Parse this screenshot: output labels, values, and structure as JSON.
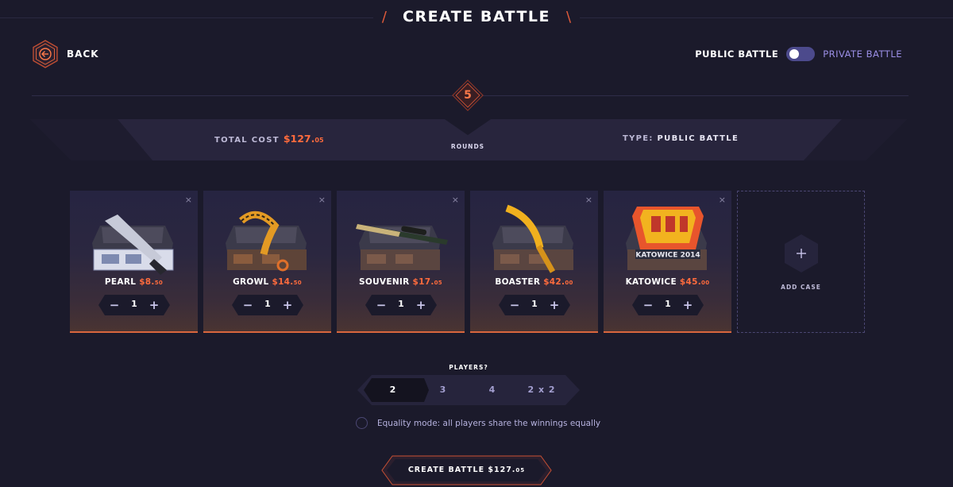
{
  "header": {
    "title": "CREATE BATTLE",
    "slash_left": "/",
    "slash_right": "\\"
  },
  "back": {
    "label": "BACK",
    "icon": "arrow-left-icon"
  },
  "visibility": {
    "left_label": "PUBLIC BATTLE",
    "right_label": "PRIVATE BATTLE",
    "selected": "public"
  },
  "rounds": {
    "count": "5",
    "label": "ROUNDS"
  },
  "summary": {
    "total_cost_label": "TOTAL COST",
    "total_cost_main": "$127.",
    "total_cost_cents": "05",
    "type_label": "TYPE:",
    "type_value": "PUBLIC BATTLE"
  },
  "cases": [
    {
      "name": "PEARL",
      "price_main": "$8.",
      "price_cents": "50",
      "quantity": "1",
      "art": "knife-pearl-case"
    },
    {
      "name": "GROWL",
      "price_main": "$14.",
      "price_cents": "50",
      "quantity": "1",
      "art": "karambit-growl-case"
    },
    {
      "name": "SOUVENIR",
      "price_main": "$17.",
      "price_cents": "05",
      "quantity": "1",
      "art": "sniper-souvenir-case"
    },
    {
      "name": "BOASTER",
      "price_main": "$42.",
      "price_cents": "00",
      "quantity": "1",
      "art": "knife-boaster-case"
    },
    {
      "name": "KATOWICE",
      "price_main": "$45.",
      "price_cents": "00",
      "quantity": "1",
      "art": "katowice-2014-case",
      "art_text": "KATOWICE 2014"
    }
  ],
  "stepper": {
    "minus": "−",
    "plus": "+",
    "close": "×"
  },
  "add_case": {
    "label": "ADD CASE",
    "icon": "+"
  },
  "players": {
    "label": "PLAYERS?",
    "options": [
      "2",
      "3",
      "4",
      "2 x 2"
    ],
    "selected": "2"
  },
  "equality": {
    "label": "Equality mode: all players share the winnings equally",
    "checked": false
  },
  "create_button": {
    "label": "CREATE BATTLE $127.",
    "cents": "05"
  },
  "colors": {
    "accent": "#ff6b3d",
    "background": "#1b1a2b",
    "purple": "#9b8fe6"
  }
}
